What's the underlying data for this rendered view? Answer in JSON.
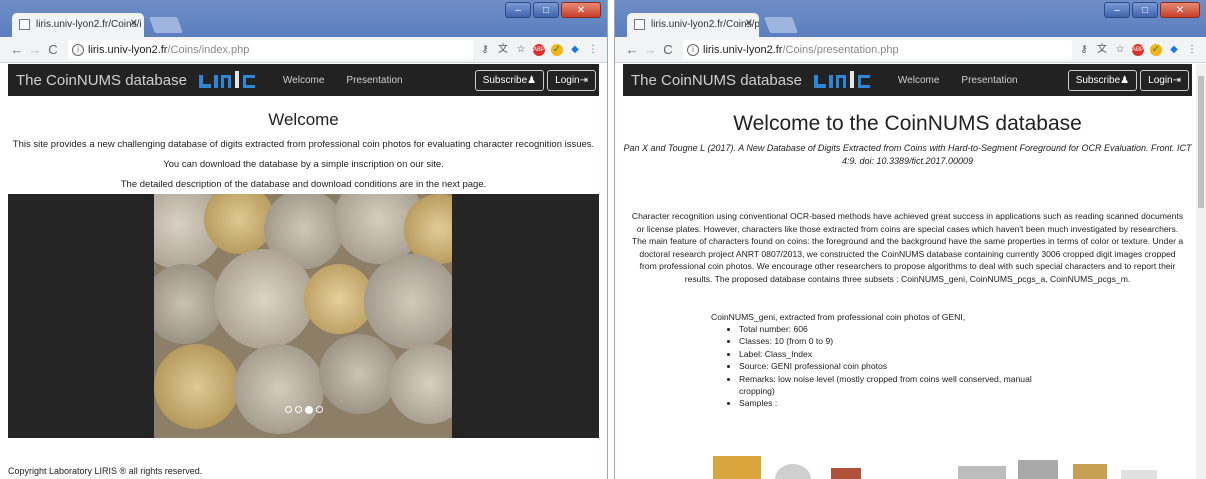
{
  "left": {
    "tab_title": "liris.univ-lyon2.fr/Coins/i",
    "url_host": "liris.univ-lyon2.fr",
    "url_path": "/Coins/index.php",
    "nav": {
      "brand": "The CoinNUMS database",
      "links": [
        "Welcome",
        "Presentation"
      ],
      "subscribe": "Subscribe",
      "login": "Login"
    },
    "heading": "Welcome",
    "paragraphs": [
      "This site provides a new challenging database of digits extracted from professional coin photos for evaluating character recognition issues.",
      "You can download the database by a simple inscription on our site.",
      "The detailed description of the database and download conditions are in the next page."
    ],
    "carousel": {
      "slide_count": 4,
      "active_index": 2
    },
    "copyright": "Copyright Laboratory LIRIS ® all rights reserved."
  },
  "right": {
    "tab_title": "liris.univ-lyon2.fr/Coins/p",
    "url_host": "liris.univ-lyon2.fr",
    "url_path": "/Coins/presentation.php",
    "heading": "Welcome to the CoinNUMS database",
    "citation": "Pan X and Tougne L (2017). A New Database of Digits Extracted from Coins with Hard-to-Segment Foreground for OCR Evaluation. Front. ICT 4:9. doi: 10.3389/fict.2017.00009",
    "abstract": "Character recognition using conventional OCR-based methods have achieved great success in applications such as reading scanned documents or license plates. However, characters like those extracted from coins are special cases which haven't been much investigated by researchers. The main feature of characters found on coins: the foreground and the background have the same properties in terms of color or texture. Under a doctoral research project ANRT 0807/2013, we constructed the CoinNUMS database containing currently 3006 cropped digit images cropped from professional coin photos. We encourage other researchers to propose algorithms to deal with such special characters and to report their results. The proposed database contains three subsets : CoinNUMS_geni, CoinNUMS_pcgs_a, CoinNUMS_pcgs_m.",
    "subset_intro": "CoinNUMS_geni, extracted from professional coin photos of GENI,",
    "subset_items": [
      "Total number: 606",
      "Classes: 10 (from 0 to 9)",
      "Label: Class_Index",
      "Source: GENI professional coin photos",
      "Remarks: low noise level (mostly cropped from coins well conserved, manual cropping)",
      "Samples :"
    ]
  },
  "colors": {
    "navbar": "#222222",
    "liris_blue": "#2f86d6",
    "titlebar": "#5b7fc0"
  },
  "icons": [
    "back-icon",
    "forward-icon",
    "reload-icon",
    "info-icon",
    "key-icon",
    "translate-icon",
    "star-icon",
    "adblock-icon",
    "chrome-ext-icon",
    "diamond-icon",
    "menu-icon",
    "user-icon",
    "login-icon"
  ]
}
